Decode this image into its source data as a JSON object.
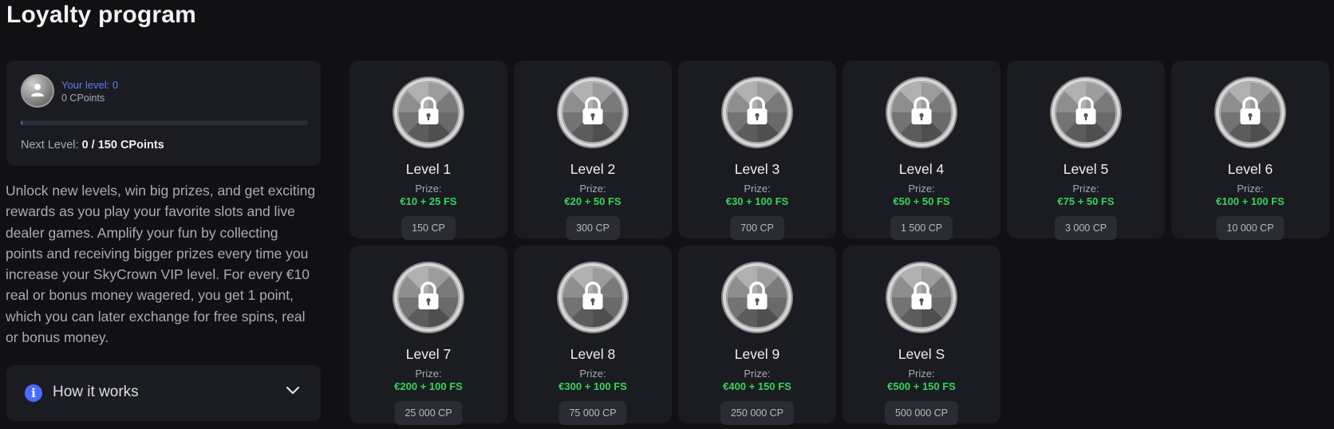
{
  "page": {
    "title": "Loyalty program"
  },
  "status": {
    "your_level": "Your level: 0",
    "cpoints": "0 CPoints",
    "progress_fraction": 0.005,
    "next_level_label": "Next Level:",
    "next_level_value": "0 / 150 CPoints"
  },
  "description": "Unlock new levels, win big prizes, and get exciting rewards as you play your favorite slots and live dealer games. Amplify your fun by collecting points and receiving bigger prizes every time you increase your SkyCrown VIP level. For every €10 real or bonus money wagered, you get 1 point, which you can later exchange for free spins, real or bonus money.",
  "how_it_works": {
    "label": "How it works",
    "icon": "info-icon",
    "chevron": "chevron-down-icon"
  },
  "prize_label": "Prize:",
  "levels": [
    {
      "name": "Level 1",
      "prize": "€10 + 25 FS",
      "cp": "150 CP"
    },
    {
      "name": "Level 2",
      "prize": "€20 + 50 FS",
      "cp": "300 CP"
    },
    {
      "name": "Level 3",
      "prize": "€30 + 100 FS",
      "cp": "700 CP"
    },
    {
      "name": "Level 4",
      "prize": "€50 + 50 FS",
      "cp": "1 500 CP"
    },
    {
      "name": "Level 5",
      "prize": "€75 + 50 FS",
      "cp": "3 000 CP"
    },
    {
      "name": "Level 6",
      "prize": "€100 + 100 FS",
      "cp": "10 000 CP"
    },
    {
      "name": "Level 7",
      "prize": "€200 + 100 FS",
      "cp": "25 000 CP"
    },
    {
      "name": "Level 8",
      "prize": "€300 + 100 FS",
      "cp": "75 000 CP"
    },
    {
      "name": "Level 9",
      "prize": "€400 + 150 FS",
      "cp": "250 000 CP"
    },
    {
      "name": "Level S",
      "prize": "€500 + 150 FS",
      "cp": "500 000 CP"
    }
  ],
  "colors": {
    "accent": "#4b6bff",
    "prize_green": "#37d45a",
    "card_bg": "#1b1c21",
    "page_bg": "#111114"
  },
  "icons": {
    "medal": "locked-medal-icon",
    "avatar": "user-avatar-icon"
  }
}
